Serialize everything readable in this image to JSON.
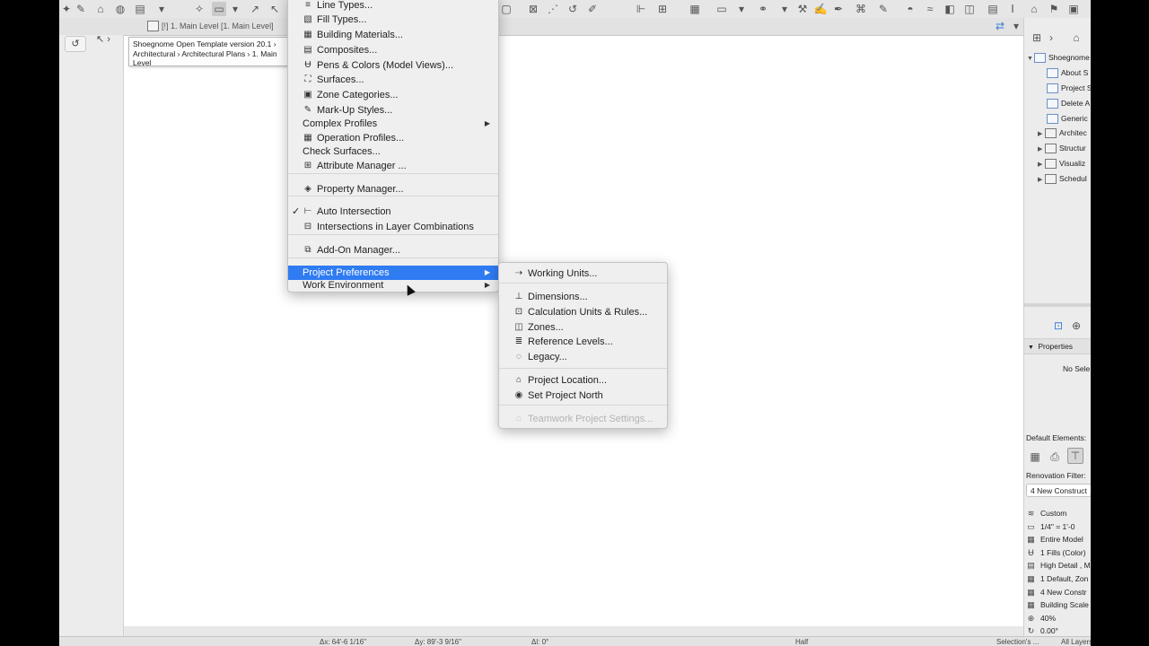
{
  "tab": {
    "label": "[!] 1. Main Level [1. Main Level]"
  },
  "tooltip": {
    "text": "Shoegnome Open Template version 20.1 › Architectural › Architectural Plans › 1. Main Level"
  },
  "main_menu": {
    "items": [
      {
        "icon": "line-types-icon",
        "glyph": "≡",
        "label": "Line Types..."
      },
      {
        "icon": "fill-types-icon",
        "glyph": "▧",
        "label": "Fill Types..."
      },
      {
        "icon": "building-materials-icon",
        "glyph": "▦",
        "label": "Building Materials..."
      },
      {
        "icon": "composites-icon",
        "glyph": "▤",
        "label": "Composites..."
      },
      {
        "icon": "pens-colors-icon",
        "glyph": "Ʉ",
        "label": "Pens & Colors (Model Views)..."
      },
      {
        "icon": "surfaces-icon",
        "glyph": "⛶",
        "label": "Surfaces..."
      },
      {
        "icon": "zone-categories-icon",
        "glyph": "▣",
        "label": "Zone Categories..."
      },
      {
        "icon": "markup-styles-icon",
        "glyph": "✎",
        "label": "Mark-Up Styles..."
      },
      {
        "icon": "",
        "glyph": "",
        "label": "Complex Profiles",
        "submenu": true
      },
      {
        "icon": "operation-profiles-icon",
        "glyph": "▦",
        "label": "Operation Profiles..."
      },
      {
        "icon": "",
        "glyph": "",
        "label": "Check Surfaces..."
      },
      {
        "icon": "attribute-manager-icon",
        "glyph": "⊞",
        "label": "Attribute Manager ..."
      },
      {
        "icon": "property-manager-icon",
        "glyph": "◈",
        "label": "Property Manager..."
      },
      {
        "icon": "auto-intersection-icon",
        "glyph": "⊢",
        "label": "Auto Intersection",
        "checked": true
      },
      {
        "icon": "intersections-layer-icon",
        "glyph": "⊟",
        "label": "Intersections in Layer Combinations"
      },
      {
        "icon": "addon-manager-icon",
        "glyph": "⧉",
        "label": "Add-On Manager..."
      },
      {
        "icon": "",
        "glyph": "",
        "label": "Project Preferences",
        "submenu": true,
        "highlight": true
      },
      {
        "icon": "",
        "glyph": "",
        "label": "Work Environment",
        "submenu": true
      }
    ],
    "checkmark": "✓"
  },
  "submenu": {
    "items": [
      {
        "icon": "working-units-icon",
        "glyph": "⇢",
        "label": "Working Units..."
      },
      {
        "icon": "dimensions-icon",
        "glyph": "⊥",
        "label": "Dimensions..."
      },
      {
        "icon": "calculation-units-icon",
        "glyph": "⊡",
        "label": "Calculation Units & Rules..."
      },
      {
        "icon": "zones-icon",
        "glyph": "◫",
        "label": "Zones..."
      },
      {
        "icon": "reference-levels-icon",
        "glyph": "≣",
        "label": "Reference Levels..."
      },
      {
        "icon": "legacy-icon",
        "glyph": "◌",
        "label": "Legacy..."
      },
      {
        "icon": "project-location-icon",
        "glyph": "⌂",
        "label": "Project Location..."
      },
      {
        "icon": "set-project-north-icon",
        "glyph": "◉",
        "label": "Set Project North"
      },
      {
        "icon": "teamwork-settings-icon",
        "glyph": "⌂",
        "label": "Teamwork Project Settings...",
        "disabled": true
      }
    ]
  },
  "arrow_glyph": "▶",
  "navigator": {
    "root": "Shoegnome",
    "items": [
      "About S",
      "Project S",
      "Delete A",
      "Generic"
    ],
    "folders": [
      "Architec",
      "Structur",
      "Visualiz",
      "Schedul"
    ]
  },
  "properties": {
    "header": "Properties",
    "empty_text": "No Sele"
  },
  "default_elements": {
    "label": "Default Elements:"
  },
  "renovation": {
    "label": "Renovation Filter:",
    "value": "4 New Construct"
  },
  "settings_rows": [
    {
      "icon": "layers-icon",
      "glyph": "≋",
      "value": "Custom"
    },
    {
      "icon": "scale-icon",
      "glyph": "▭",
      "value": "1/4\"  =  1'-0"
    },
    {
      "icon": "structure-display-icon",
      "glyph": "▦",
      "value": "Entire Model"
    },
    {
      "icon": "pen-set-icon",
      "glyph": "Ʉ",
      "value": "1 Fills (Color)"
    },
    {
      "icon": "model-view-icon",
      "glyph": "▤",
      "value": "High Detail , M"
    },
    {
      "icon": "dimension-style-icon",
      "glyph": "▦",
      "value": "1 Default, Zon"
    },
    {
      "icon": "renovation-icon",
      "glyph": "▦",
      "value": "4 New Constr"
    },
    {
      "icon": "building-scale-icon",
      "glyph": "▦",
      "value": "Building Scale"
    },
    {
      "icon": "zoom-icon",
      "glyph": "⊕",
      "value": "40%"
    },
    {
      "icon": "rotation-icon",
      "glyph": "↻",
      "value": "0.00°"
    }
  ],
  "statusbar": {
    "coord1": "Δx: 64'-6 1/16\"",
    "coord2": "Δy: 89'-3 9/16\"",
    "angle": "Δl: 0°",
    "half": "Half",
    "selection": "Selection's ...",
    "layers": "All Layers"
  }
}
